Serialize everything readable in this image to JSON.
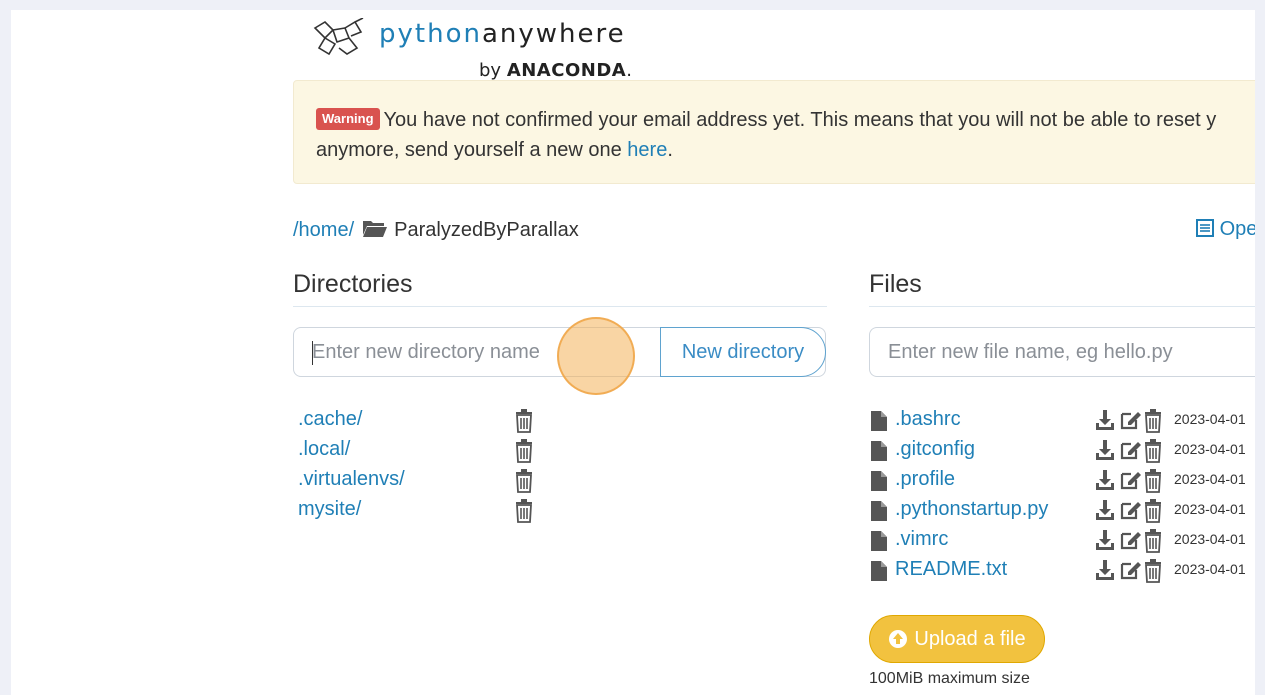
{
  "logo": {
    "python": "python",
    "anywhere": "anywhere",
    "by": "by",
    "anaconda": "ANACONDA",
    "dot": "."
  },
  "warning": {
    "badge": "Warning",
    "message": "You have not confirmed your email address yet. This means that you will not be able to reset y",
    "message_line2": "anymore, send yourself a new one",
    "link": "here",
    "period": "."
  },
  "breadcrumb": {
    "root": "/home/",
    "current": "ParalyzedByParallax"
  },
  "open_link": "Ope",
  "directories": {
    "title": "Directories",
    "input_placeholder": "Enter new directory name",
    "button": "New directory",
    "items": [
      {
        "name": ".cache/"
      },
      {
        "name": ".local/"
      },
      {
        "name": ".virtualenvs/"
      },
      {
        "name": "mysite/"
      }
    ]
  },
  "files": {
    "title": "Files",
    "input_placeholder": "Enter new file name, eg hello.py",
    "items": [
      {
        "name": ".bashrc",
        "date": "2023-04-01"
      },
      {
        "name": ".gitconfig",
        "date": "2023-04-01"
      },
      {
        "name": ".profile",
        "date": "2023-04-01"
      },
      {
        "name": ".pythonstartup.py",
        "date": "2023-04-01"
      },
      {
        "name": ".vimrc",
        "date": "2023-04-01"
      },
      {
        "name": "README.txt",
        "date": "2023-04-01"
      }
    ],
    "upload_button": "Upload a file",
    "upload_note": "100MiB maximum size"
  },
  "colors": {
    "link": "#1f7fb6",
    "warning_bg": "#fcf7e3",
    "badge": "#d9534f",
    "upload": "#f2c23f",
    "page_bg": "#eef0f7"
  }
}
